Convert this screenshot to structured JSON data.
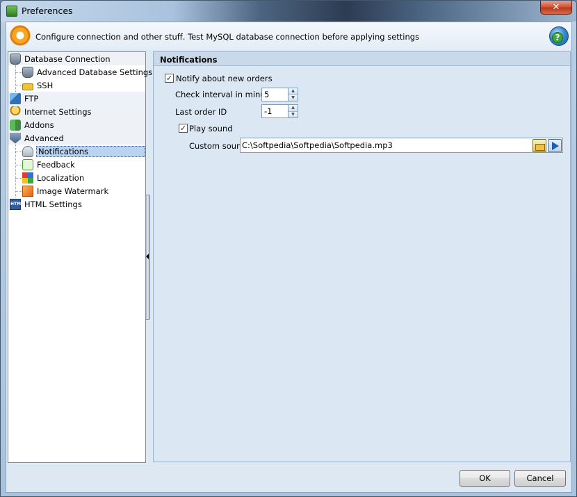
{
  "window": {
    "title": "Preferences",
    "close_label": "✕"
  },
  "header": {
    "text": "Configure connection and other stuff. Test MySQL database connection before applying settings"
  },
  "tree": {
    "items": [
      {
        "label": "Database Connection",
        "icon": "database-icon",
        "level": 0
      },
      {
        "label": "Advanced Database Settings",
        "icon": "database-settings-icon",
        "level": 1
      },
      {
        "label": "SSH",
        "icon": "lock-icon",
        "level": 1
      },
      {
        "label": "FTP",
        "icon": "ftp-icon",
        "level": 0
      },
      {
        "label": "Internet Settings",
        "icon": "internet-icon",
        "level": 0
      },
      {
        "label": "Addons",
        "icon": "puzzle-icon",
        "level": 0
      },
      {
        "label": "Advanced",
        "icon": "shield-icon",
        "level": 0
      },
      {
        "label": "Notifications",
        "icon": "bell-icon",
        "level": 1,
        "selected": true
      },
      {
        "label": "Feedback",
        "icon": "feedback-icon",
        "level": 1
      },
      {
        "label": "Localization",
        "icon": "flags-icon",
        "level": 1
      },
      {
        "label": "Image Watermark",
        "icon": "image-icon",
        "level": 1
      },
      {
        "label": "HTML Settings",
        "icon": "html-icon",
        "level": 0
      }
    ]
  },
  "notifications": {
    "section_title": "Notifications",
    "notify_label": "Notify about new orders",
    "notify_checked": true,
    "check_interval_label": "Check interval in minutes",
    "check_interval_value": "5",
    "last_order_label": "Last order ID",
    "last_order_value": "-1",
    "play_sound_label": "Play sound",
    "play_sound_checked": true,
    "custom_sound_label": "Custom sound",
    "custom_sound_value": "C:\\Softpedia\\Softpedia\\Softpedia.mp3"
  },
  "footer": {
    "ok_label": "OK",
    "cancel_label": "Cancel"
  },
  "colors": {
    "accent": "#b9d3f0",
    "panel_bg": "#dbe7f3"
  }
}
